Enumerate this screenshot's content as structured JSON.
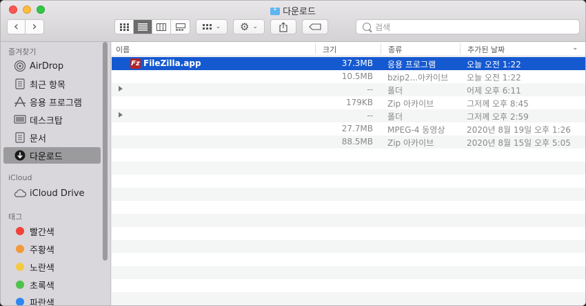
{
  "window": {
    "title": "다운로드"
  },
  "toolbar": {
    "back": "‹",
    "forward": "›",
    "search_placeholder": "검색"
  },
  "sidebar": {
    "favorites_header": "즐겨찾기",
    "favorites": [
      {
        "label": "AirDrop",
        "icon": "airdrop-icon"
      },
      {
        "label": "최근 항목",
        "icon": "recents-icon"
      },
      {
        "label": "응용 프로그램",
        "icon": "applications-icon"
      },
      {
        "label": "데스크탑",
        "icon": "desktop-icon"
      },
      {
        "label": "문서",
        "icon": "documents-icon"
      },
      {
        "label": "다운로드",
        "icon": "downloads-icon",
        "selected": true
      }
    ],
    "icloud_header": "iCloud",
    "icloud": [
      {
        "label": "iCloud Drive",
        "icon": "cloud-icon"
      }
    ],
    "tags_header": "태그",
    "tags": [
      {
        "label": "빨간색",
        "color": "#f0413b"
      },
      {
        "label": "주황색",
        "color": "#f29a38"
      },
      {
        "label": "노란색",
        "color": "#f5c944"
      },
      {
        "label": "초록색",
        "color": "#4ec24c"
      },
      {
        "label": "파란색",
        "color": "#2f86f0"
      }
    ]
  },
  "columns": {
    "name": "이름",
    "size": "크기",
    "kind": "종류",
    "date_added": "추가된 날짜"
  },
  "files": [
    {
      "name": "FileZilla.app",
      "size": "37.3MB",
      "kind": "응용 프로그램",
      "date": "오늘 오전 1:22",
      "selected": true,
      "disclosure": false
    },
    {
      "name": "",
      "size": "10.5MB",
      "kind": "bzip2...아카이브",
      "date": "오늘 오전 1:22",
      "disclosure": false
    },
    {
      "name": "",
      "size": "--",
      "kind": "폴더",
      "date": "어제 오후 6:11",
      "disclosure": true
    },
    {
      "name": "",
      "size": "179KB",
      "kind": "Zip 아카이브",
      "date": "그저께 오후 8:45",
      "disclosure": false
    },
    {
      "name": "",
      "size": "--",
      "kind": "폴더",
      "date": "그저께 오후 2:59",
      "disclosure": true
    },
    {
      "name": "",
      "size": "27.7MB",
      "kind": "MPEG-4 동영상",
      "date": "2020년 8월 19일 오후 1:26",
      "disclosure": false
    },
    {
      "name": "",
      "size": "88.5MB",
      "kind": "Zip 아카이브",
      "date": "2020년 8월 15일 오후 5:05",
      "disclosure": false
    }
  ]
}
